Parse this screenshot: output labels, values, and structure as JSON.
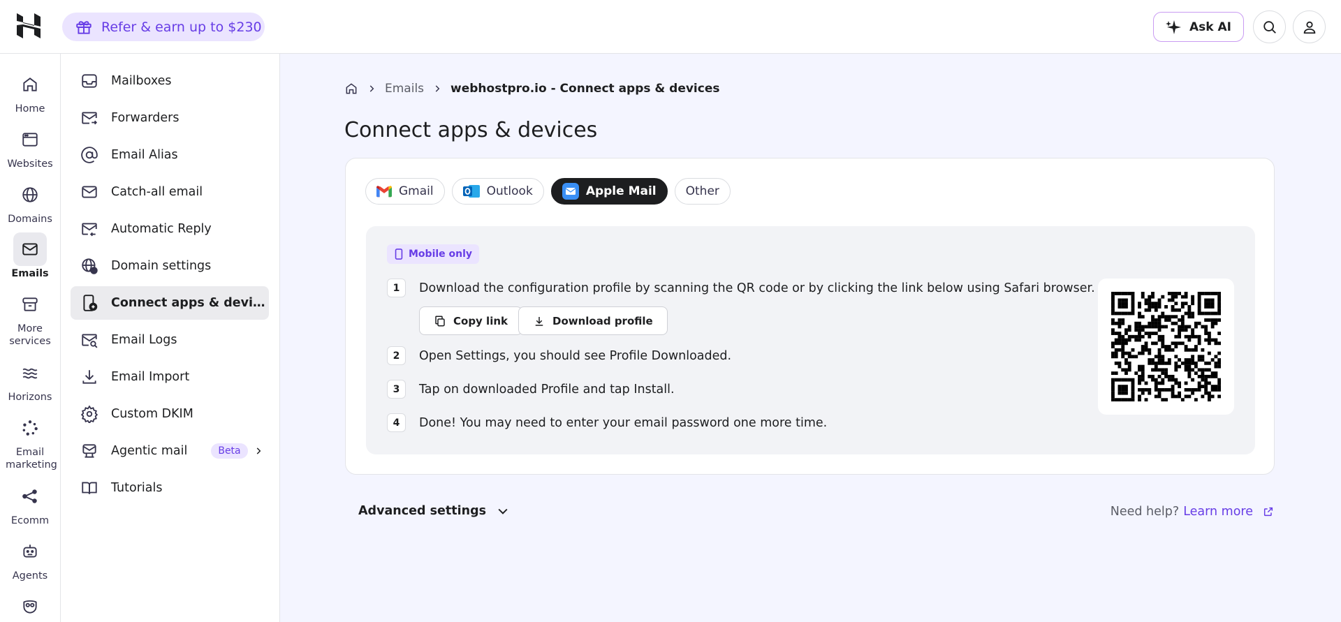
{
  "topbar": {
    "refer_label": "Refer & earn up to $230",
    "ask_ai_label": "Ask AI"
  },
  "rail": [
    {
      "label": "Home",
      "icon": "home-icon"
    },
    {
      "label": "Websites",
      "icon": "browser-window-icon"
    },
    {
      "label": "Domains",
      "icon": "globe-icon"
    },
    {
      "label": "Emails",
      "icon": "envelope-icon",
      "active": true
    },
    {
      "label": "More services",
      "icon": "box-icon"
    },
    {
      "label": "Horizons",
      "icon": "waves-icon"
    },
    {
      "label": "Email marketing",
      "icon": "sparkle-dots-icon"
    },
    {
      "label": "Ecomm",
      "icon": "share-nodes-icon"
    },
    {
      "label": "Agents",
      "icon": "robot-icon"
    },
    {
      "label": "",
      "icon": "owl-icon"
    }
  ],
  "subnav": [
    {
      "label": "Mailboxes",
      "icon": "inbox-icon"
    },
    {
      "label": "Forwarders",
      "icon": "forward-mail-icon"
    },
    {
      "label": "Email Alias",
      "icon": "at-sign-icon"
    },
    {
      "label": "Catch-all email",
      "icon": "envelope-icon"
    },
    {
      "label": "Automatic Reply",
      "icon": "reply-mail-icon"
    },
    {
      "label": "Domain settings",
      "icon": "globe-gear-icon"
    },
    {
      "label": "Connect apps & devi…",
      "icon": "device-plus-icon",
      "active": true
    },
    {
      "label": "Email Logs",
      "icon": "mail-search-icon"
    },
    {
      "label": "Email Import",
      "icon": "download-icon"
    },
    {
      "label": "Custom DKIM",
      "icon": "gear-icon"
    },
    {
      "label": "Agentic mail",
      "icon": "agent-mail-icon",
      "badge": "Beta"
    },
    {
      "label": "Tutorials",
      "icon": "book-icon"
    }
  ],
  "breadcrumb": {
    "emails": "Emails",
    "current": "webhostpro.io - Connect apps & devices"
  },
  "page_title": "Connect apps & devices",
  "tabs": [
    {
      "label": "Gmail",
      "icon": "gmail-icon"
    },
    {
      "label": "Outlook",
      "icon": "outlook-icon"
    },
    {
      "label": "Apple Mail",
      "icon": "apple-mail-icon",
      "active": true
    },
    {
      "label": "Other",
      "icon": ""
    }
  ],
  "mobile_badge": "Mobile only",
  "steps": [
    {
      "num": "1",
      "text": "Download the configuration profile by scanning the QR code or by clicking the link below using Safari browser."
    },
    {
      "num": "2",
      "text": "Open Settings, you should see Profile Downloaded."
    },
    {
      "num": "3",
      "text": "Tap on downloaded Profile and tap Install."
    },
    {
      "num": "4",
      "text": "Done! You may need to enter your email password one more time."
    }
  ],
  "buttons": {
    "copy_link": "Copy link",
    "download_profile": "Download profile"
  },
  "advanced_settings": "Advanced settings",
  "help": {
    "prefix": "Need help?",
    "link": "Learn more"
  },
  "colors": {
    "accent": "#673de6",
    "accent_light": "#ebe4ff",
    "dark": "#1d1e20",
    "page_bg": "#f4f5ff"
  }
}
